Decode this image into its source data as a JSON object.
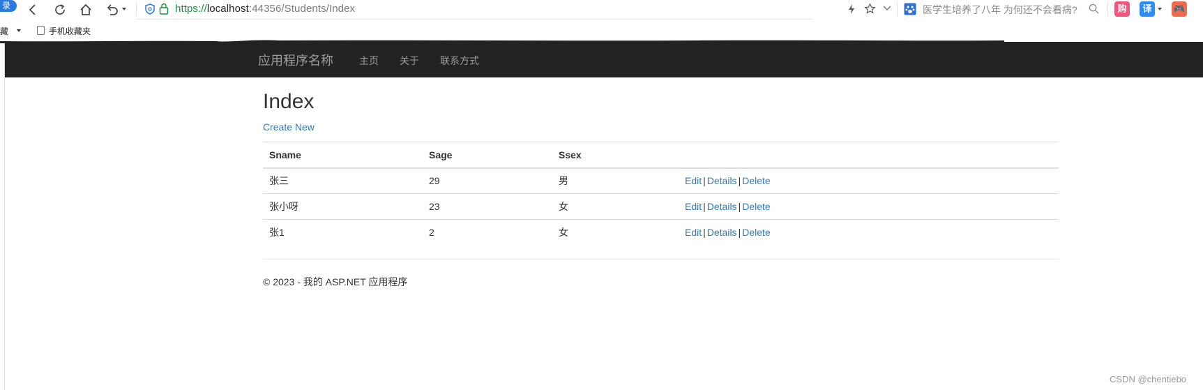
{
  "browser": {
    "login_pill": "录",
    "url": {
      "scheme": "https://",
      "host": "localhost",
      "rest": ":44356/Students/Index"
    },
    "search_hint": "医学生培养了八年 为何还不会看病?",
    "badges": [
      {
        "label": "购",
        "color": "#f2557a"
      },
      {
        "label": "译",
        "color": "#2c8ef5"
      },
      {
        "label": "🎮",
        "color": "#f36b4e"
      }
    ],
    "bookmarks": {
      "item1": "收藏",
      "item2": "手机收藏夹"
    }
  },
  "navbar": {
    "brand": "应用程序名称",
    "links": [
      "主页",
      "关于",
      "联系方式"
    ]
  },
  "page": {
    "title": "Index",
    "create_link": "Create New",
    "columns": [
      "Sname",
      "Sage",
      "Ssex"
    ],
    "rows": [
      {
        "name": "张三",
        "age": "29",
        "sex": "男"
      },
      {
        "name": "张小呀",
        "age": "23",
        "sex": "女"
      },
      {
        "name": "张1",
        "age": "2",
        "sex": "女"
      }
    ],
    "actions": {
      "edit": "Edit",
      "details": "Details",
      "delete": "Delete",
      "sep": "|"
    },
    "footer": "© 2023 - 我的 ASP.NET 应用程序"
  },
  "watermark": "CSDN @chentiebo",
  "colors": {
    "navbar_bg": "#222222",
    "link": "#337ab7",
    "brand_text": "#9d9d9d",
    "url_secure": "#1a8f3c"
  }
}
